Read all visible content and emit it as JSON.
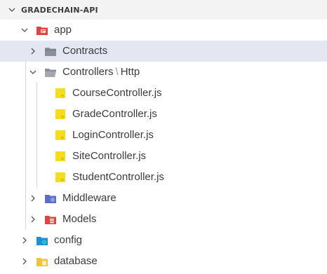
{
  "explorer": {
    "section_title": "GRADECHAIN-API",
    "tree": {
      "app": {
        "label": "app",
        "expanded": true
      },
      "contracts": {
        "label": "Contracts",
        "expanded": false,
        "selected": true
      },
      "controllers": {
        "label": "Controllers",
        "separator": "\\",
        "sublabel": "Http",
        "expanded": true
      },
      "files": [
        {
          "label": "CourseController.js",
          "icon": "js-file-icon"
        },
        {
          "label": "GradeController.js",
          "icon": "js-file-icon"
        },
        {
          "label": "LoginController.js",
          "icon": "js-file-icon"
        },
        {
          "label": "SiteController.js",
          "icon": "js-file-icon"
        },
        {
          "label": "StudentController.js",
          "icon": "js-file-icon"
        }
      ],
      "middleware": {
        "label": "Middleware",
        "expanded": false
      },
      "models": {
        "label": "Models",
        "expanded": false
      },
      "config": {
        "label": "config",
        "expanded": false
      },
      "database": {
        "label": "database",
        "expanded": false
      }
    }
  },
  "colors": {
    "app_folder": "#e0443e",
    "contracts_folder": "#8a8f98",
    "controllers_folder": "#8a8f98",
    "js_file": "#f5de19",
    "middleware_folder": "#5b6fc9",
    "models_folder": "#e0443e",
    "config_folder": "#1f8fd6",
    "database_folder": "#f2c43d",
    "selection": "#e4e6f1"
  }
}
